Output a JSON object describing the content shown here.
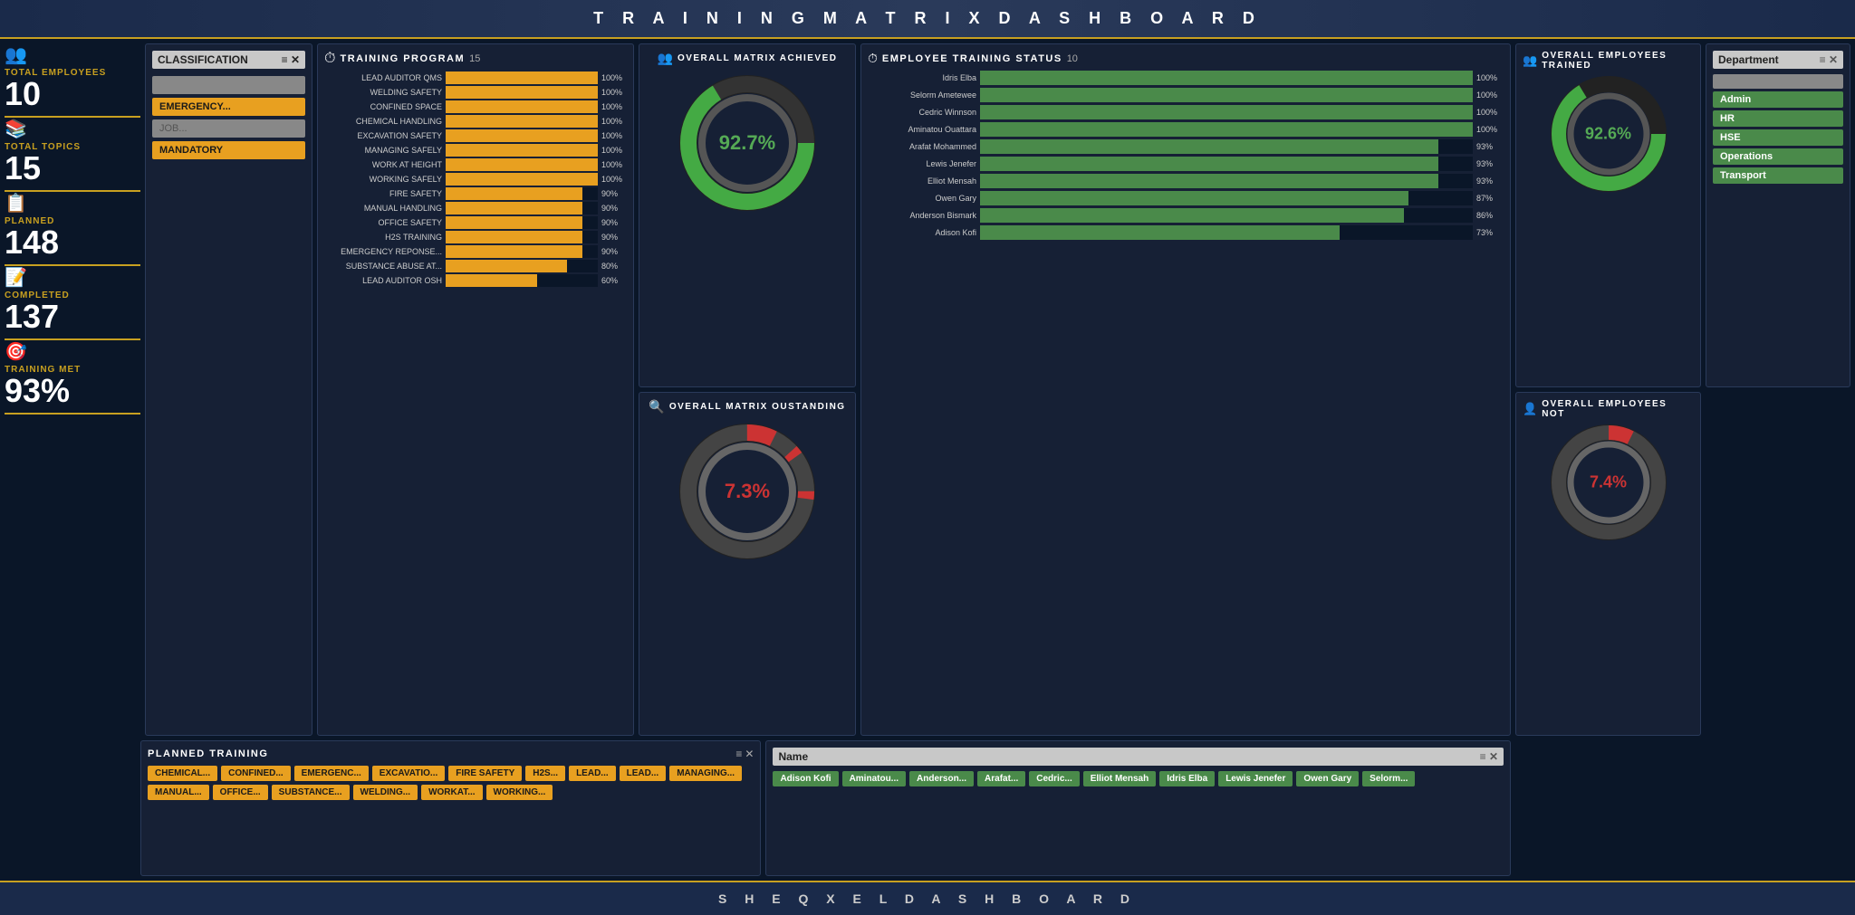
{
  "header": {
    "title": "T R A I N I N G   M A T R I X   D A S H B O A R D"
  },
  "footer": {
    "title": "S H E Q X E L   D A S H B O A R D"
  },
  "stats": {
    "total_employees_label": "TOTAL EMPLOYEES",
    "total_employees_value": "10",
    "total_topics_label": "TOTAL TOPICS",
    "total_topics_value": "15",
    "planned_label": "PLANNED",
    "planned_value": "148",
    "completed_label": "COMPLETED",
    "completed_value": "137",
    "training_met_label": "TRAINING MET",
    "training_met_value": "93%"
  },
  "classification": {
    "header": "CLASSIFICATION",
    "items": [
      {
        "label": "EMERGENCY...",
        "active": true
      },
      {
        "label": "JOB...",
        "active": false
      },
      {
        "label": "MANDATORY",
        "active": true
      }
    ]
  },
  "training_program": {
    "title": "TRAINING PROGRAM",
    "count": "15",
    "bars": [
      {
        "label": "LEAD AUDITOR QMS",
        "pct": 100
      },
      {
        "label": "WELDING SAFETY",
        "pct": 100
      },
      {
        "label": "CONFINED SPACE",
        "pct": 100
      },
      {
        "label": "CHEMICAL HANDLING",
        "pct": 100
      },
      {
        "label": "EXCAVATION SAFETY",
        "pct": 100
      },
      {
        "label": "MANAGING SAFELY",
        "pct": 100
      },
      {
        "label": "WORK AT HEIGHT",
        "pct": 100
      },
      {
        "label": "WORKING SAFELY",
        "pct": 100
      },
      {
        "label": "FIRE SAFETY",
        "pct": 90
      },
      {
        "label": "MANUAL HANDLING",
        "pct": 90
      },
      {
        "label": "OFFICE SAFETY",
        "pct": 90
      },
      {
        "label": "H2S TRAINING",
        "pct": 90
      },
      {
        "label": "EMERGENCY REPONSE...",
        "pct": 90
      },
      {
        "label": "SUBSTANCE ABUSE AT...",
        "pct": 80
      },
      {
        "label": "LEAD AUDITOR OSH",
        "pct": 60
      }
    ]
  },
  "overall_matrix_achieved": {
    "title": "OVERALL MATRIX ACHIEVED",
    "value": "92.7%",
    "pct": 92.7
  },
  "overall_matrix_outstanding": {
    "title": "OVERALL MATRIX OUSTANDING",
    "value": "7.3%",
    "pct": 7.3
  },
  "employee_training": {
    "title": "EMPLOYEE TRAINING STATUS",
    "count": "10",
    "employees": [
      {
        "name": "Idris Elba",
        "pct": 100
      },
      {
        "name": "Selorm Ametewee",
        "pct": 100
      },
      {
        "name": "Cedric Winnson",
        "pct": 100
      },
      {
        "name": "Aminatou Ouattara",
        "pct": 100
      },
      {
        "name": "Arafat Mohammed",
        "pct": 93
      },
      {
        "name": "Lewis Jenefer",
        "pct": 93
      },
      {
        "name": "Elliot Mensah",
        "pct": 93
      },
      {
        "name": "Owen Gary",
        "pct": 87
      },
      {
        "name": "Anderson Bismark",
        "pct": 86
      },
      {
        "name": "Adison Kofi",
        "pct": 73
      }
    ]
  },
  "overall_employees_trained": {
    "title": "OVERALL EMPLOYEES TRAINED",
    "value": "92.6%",
    "pct": 92.6
  },
  "overall_employees_not": {
    "title": "OVERALL EMPLOYEES NOT",
    "value": "7.4%",
    "pct": 7.4
  },
  "department": {
    "header": "Department",
    "items": [
      {
        "label": "Admin",
        "active": true
      },
      {
        "label": "HR",
        "active": true
      },
      {
        "label": "HSE",
        "active": true
      },
      {
        "label": "Operations",
        "active": true
      },
      {
        "label": "Transport",
        "active": true
      }
    ]
  },
  "planned_training": {
    "title": "PLANNED TRAINING",
    "tags": [
      "CHEMICAL...",
      "CONFINED...",
      "EMERGENC...",
      "EXCAVATIO...",
      "FIRE SAFETY",
      "H2S...",
      "LEAD...",
      "LEAD...",
      "MANAGING...",
      "MANUAL...",
      "OFFICE...",
      "SUBSTANCE...",
      "WELDING...",
      "WORKAT...",
      "WORKING..."
    ]
  },
  "name_filter": {
    "header": "Name",
    "names": [
      "Adison Kofi",
      "Aminatou...",
      "Anderson...",
      "Arafat...",
      "Cedric...",
      "Elliot Mensah",
      "Idris Elba",
      "Lewis Jenefer",
      "Owen Gary",
      "Selorm..."
    ]
  }
}
